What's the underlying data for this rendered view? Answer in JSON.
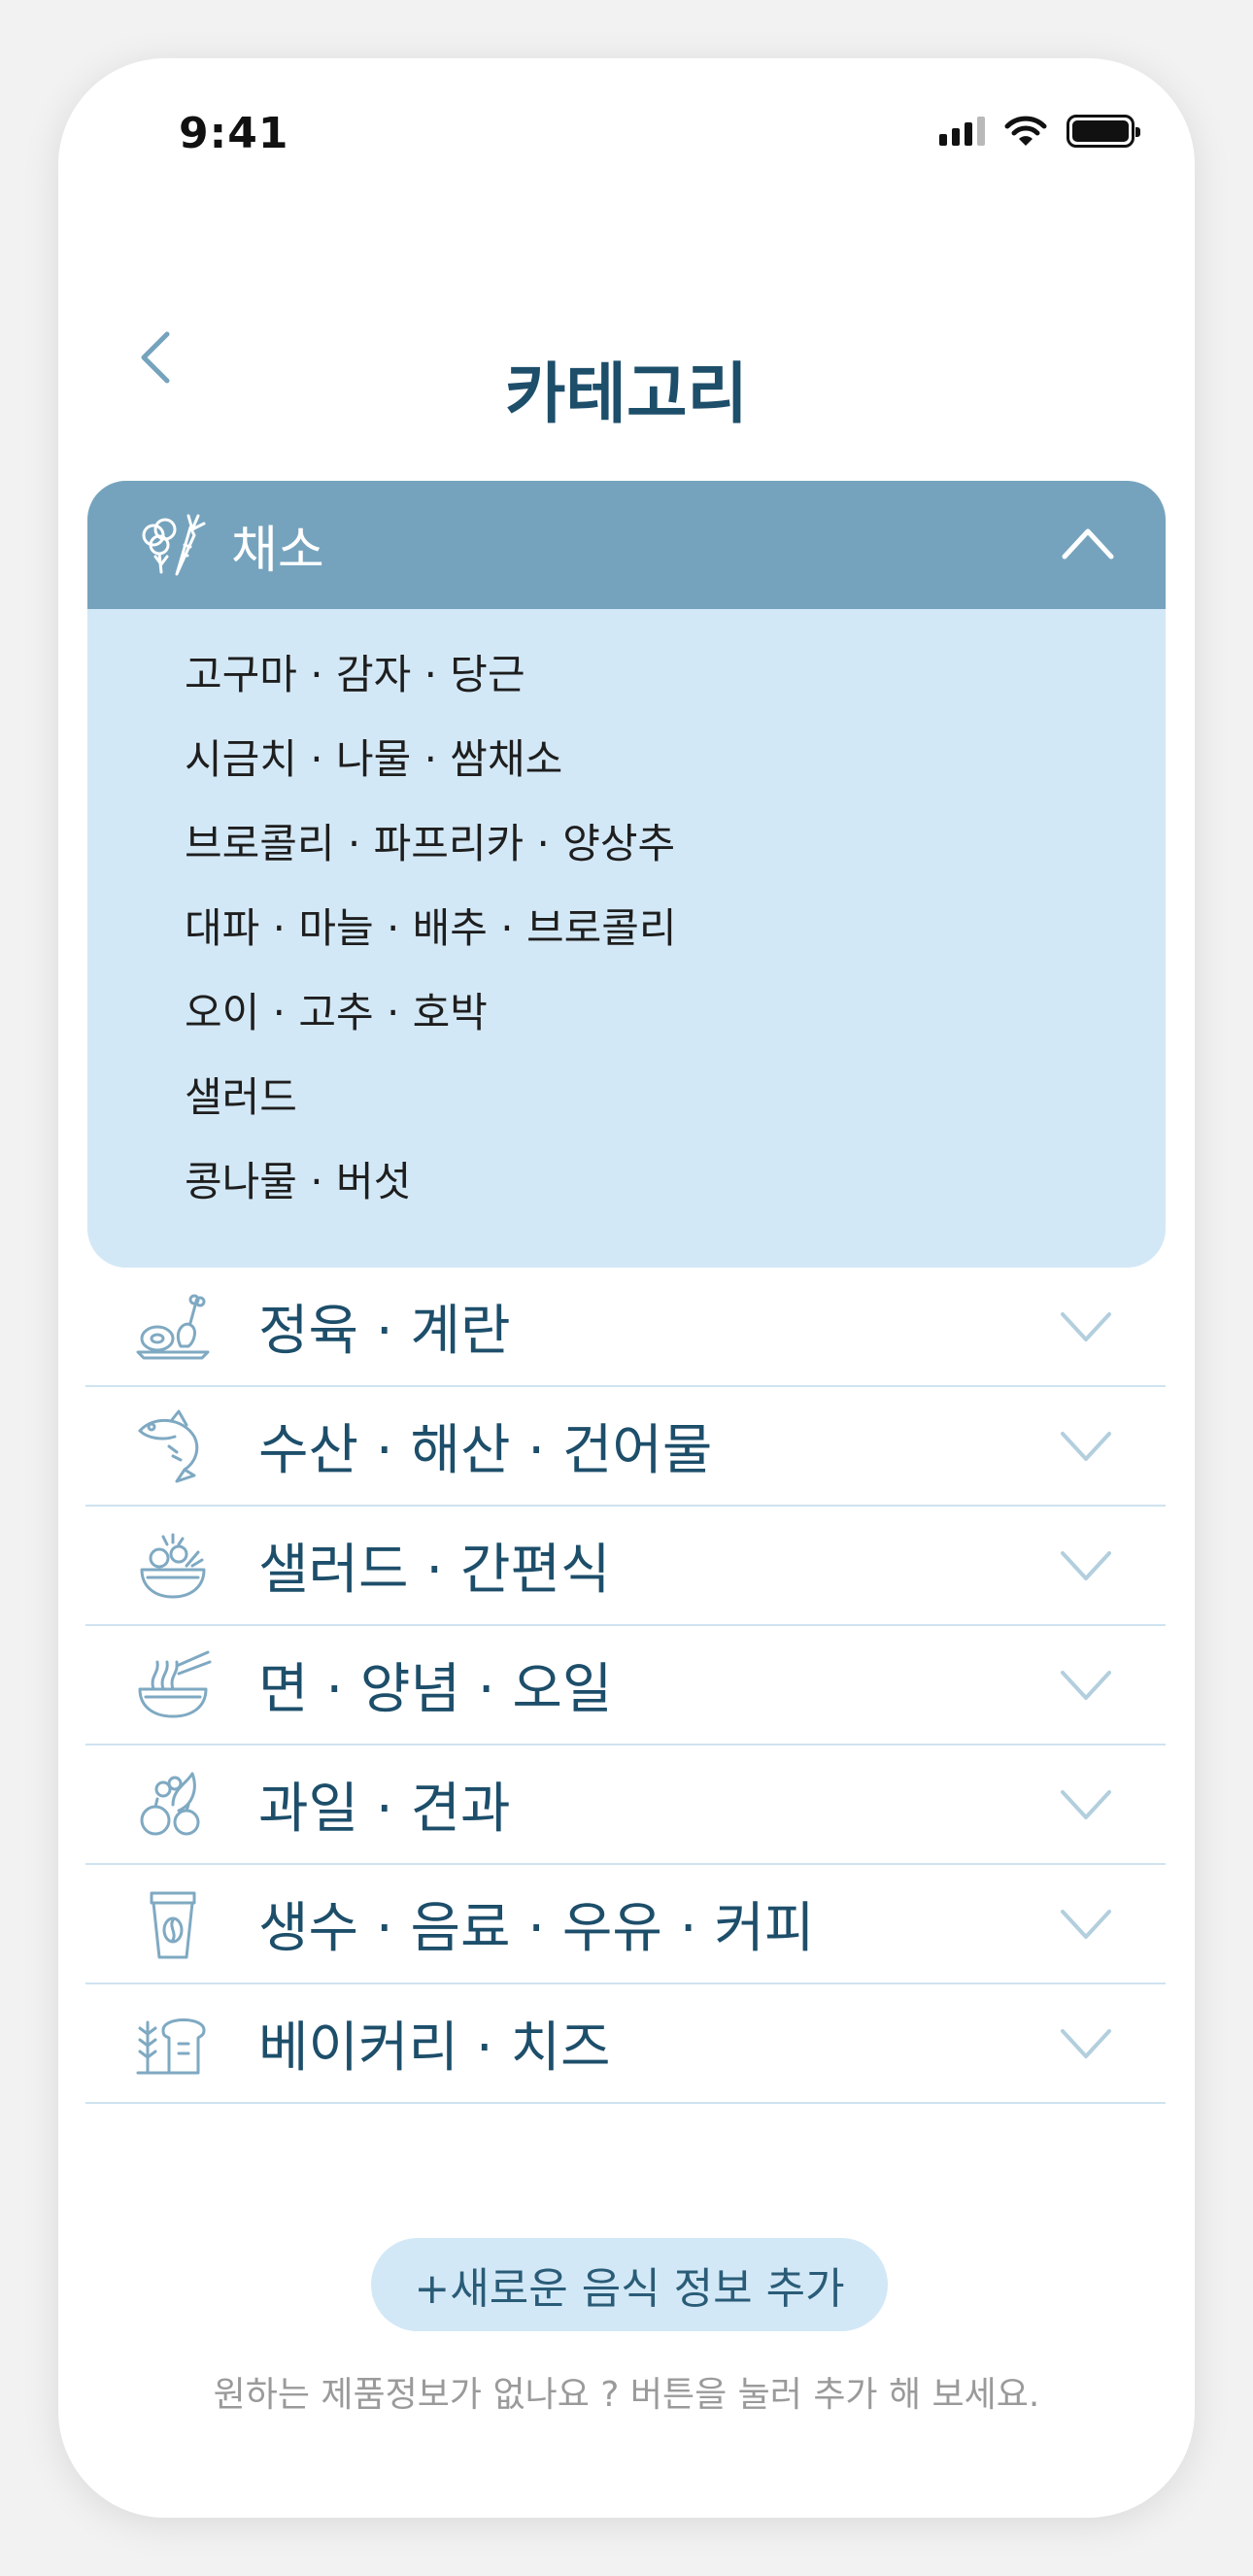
{
  "status_bar": {
    "time": "9:41"
  },
  "header": {
    "title": "카테고리"
  },
  "expanded_category": {
    "label": "채소",
    "icon": "vegetable-icon",
    "items": [
      "고구마 · 감자 · 당근",
      "시금치 · 나물 · 쌈채소",
      "브로콜리 · 파프리카 · 양상추",
      "대파 · 마늘 · 배추 · 브로콜리",
      "오이 · 고추 · 호박",
      "샐러드",
      "콩나물 · 버섯"
    ]
  },
  "categories": [
    {
      "label": "정육 · 계란",
      "icon": "meat-icon"
    },
    {
      "label": "수산 · 해산 · 건어물",
      "icon": "fish-icon"
    },
    {
      "label": "샐러드 · 간편식",
      "icon": "salad-icon"
    },
    {
      "label": "면 · 양념 · 오일",
      "icon": "noodle-icon"
    },
    {
      "label": "과일 · 견과",
      "icon": "fruit-icon"
    },
    {
      "label": "생수 · 음료 · 우유 · 커피",
      "icon": "coffee-cup-icon"
    },
    {
      "label": "베이커리 · 치즈",
      "icon": "bread-icon"
    }
  ],
  "add_button": {
    "label": "+새로운 음식 정보 추가"
  },
  "helper_text": "원하는 제품정보가 없나요 ? 버튼을 눌러 추가 해 보세요.",
  "colors": {
    "title": "#1d4e6a",
    "accent": "#75a3bd",
    "light_accent": "#d3e8f6",
    "divider": "#cfe3ef"
  }
}
